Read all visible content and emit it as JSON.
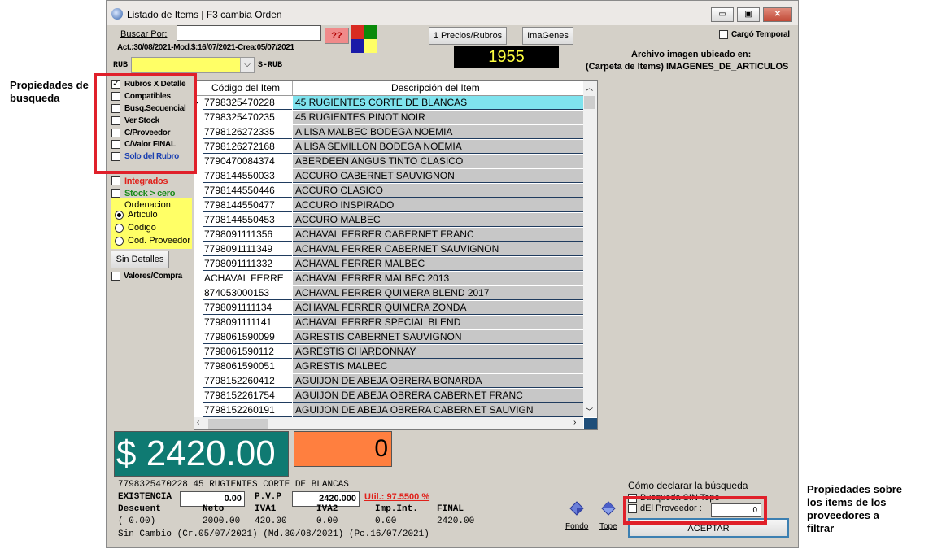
{
  "annotations": {
    "left_label": "Propiedades de\nbusqueda",
    "right_label": "Propiedades sobre\nlos items de los\nproveedores a\nfiltrar"
  },
  "window": {
    "title": "Listado de Items | F3 cambia Orden",
    "minimize": "▭",
    "maximize": "▣",
    "close": "✕"
  },
  "search": {
    "label": "Buscar Por:",
    "value": "",
    "help_button": "??",
    "dates": "Act.:30/08/2021-Mod.$:16/07/2021-Crea:05/07/2021"
  },
  "colors": {
    "accent_red": "#d92b22",
    "accent_green": "#0a8a0a",
    "accent_blue": "#1a1aa8",
    "accent_yellow": "#ffff66",
    "price_bg": "#0f7a72",
    "qty_bg": "#ff7f3f",
    "selected_row": "#7fe3ee",
    "counter_bg": "#000000",
    "counter_fg": "#ffff40"
  },
  "toolbar": {
    "precios_rubros": "1 Precios/Rubros",
    "imagenes": "ImaGenes",
    "counter": "1955",
    "cargo_temporal": "Cargó Temporal"
  },
  "image_info": {
    "line1": "Archivo imagen ubicado en:",
    "line2": "(Carpeta de Items) IMAGENES_DE_ARTICULOS"
  },
  "rubro": {
    "label": "RUB",
    "value": "",
    "srubro_label": "S-RUB"
  },
  "options": [
    {
      "label": "Rubros X Detalle",
      "checked": true,
      "color": "#000000"
    },
    {
      "label": "Compatibles",
      "checked": false,
      "color": "#000000"
    },
    {
      "label": "Busq.Secuencial",
      "checked": false,
      "color": "#000000"
    },
    {
      "label": "Ver Stock",
      "checked": false,
      "color": "#000000"
    },
    {
      "label": "C/Proveedor",
      "checked": false,
      "color": "#000000"
    },
    {
      "label": "C/Valor FINAL",
      "checked": false,
      "color": "#000000"
    },
    {
      "label": "Solo del Rubro",
      "checked": false,
      "color": "#1a3fb0"
    },
    {
      "label": "Integrados",
      "checked": false,
      "color": "#e0201a"
    },
    {
      "label": "Stock > cero",
      "checked": false,
      "color": "#1a8a1a"
    }
  ],
  "ordenacion": {
    "title": "Ordenacion",
    "items": [
      {
        "label": "Articulo",
        "selected": true
      },
      {
        "label": "Codigo",
        "selected": false
      },
      {
        "label": "Cod. Proveedor",
        "selected": false
      }
    ]
  },
  "sin_detalles": "Sin Detalles",
  "valores_compra": "Valores/Compra",
  "table": {
    "headers": [
      "Código del Item",
      "Descripción del Item"
    ],
    "rows": [
      [
        "7798325470228",
        "45 RUGIENTES CORTE DE BLANCAS"
      ],
      [
        "7798325470235",
        "45 RUGIENTES PINOT NOIR"
      ],
      [
        "7798126272335",
        "A LISA MALBEC BODEGA NOEMIA"
      ],
      [
        "7798126272168",
        "A LISA SEMILLON BODEGA NOEMIA"
      ],
      [
        "7790470084374",
        "ABERDEEN ANGUS  TINTO CLASICO"
      ],
      [
        "7798144550033",
        "ACCURO CABERNET SAUVIGNON"
      ],
      [
        "7798144550446",
        "ACCURO CLASICO"
      ],
      [
        "7798144550477",
        "ACCURO INSPIRADO"
      ],
      [
        "7798144550453",
        "ACCURO MALBEC"
      ],
      [
        "7798091111356",
        "ACHAVAL FERRER CABERNET FRANC"
      ],
      [
        "7798091111349",
        "ACHAVAL FERRER CABERNET SAUVIGNON"
      ],
      [
        "7798091111332",
        "ACHAVAL FERRER MALBEC"
      ],
      [
        "ACHAVAL FERRE",
        "ACHAVAL FERRER MALBEC 2013"
      ],
      [
        "874053000153",
        "ACHAVAL FERRER QUIMERA BLEND 2017"
      ],
      [
        "7798091111134",
        "ACHAVAL FERRER QUIMERA ZONDA"
      ],
      [
        "7798091111141",
        "ACHAVAL FERRER SPECIAL BLEND"
      ],
      [
        "7798061590099",
        "AGRESTIS CABERNET SAUVIGNON"
      ],
      [
        "7798061590112",
        "AGRESTIS CHARDONNAY"
      ],
      [
        "7798061590051",
        "AGRESTIS MALBEC"
      ],
      [
        "7798152260412",
        "AGUIJON DE ABEJA OBRERA BONARDA"
      ],
      [
        "7798152261754",
        "AGUIJON DE ABEJA OBRERA CABERNET FRANC"
      ],
      [
        "7798152260191",
        "AGUIJON DE ABEJA OBRERA CABERNET SAUVIGN"
      ]
    ]
  },
  "price": {
    "big": "$ 2420.00",
    "qty": "0"
  },
  "detail": {
    "item_line": "7798325470228 45 RUGIENTES CORTE DE BLANCAS",
    "existencia_label": "EXISTENCIA",
    "existencia_value": "0.00",
    "pvp_label": "P.V.P",
    "pvp_value": "2420.000",
    "util": "Util.: 97.5500 %",
    "col_headers": [
      "Descuent",
      "Neto",
      "IVA1",
      "IVA2",
      "Imp.Int.",
      "FINAL"
    ],
    "col_values": [
      "( 0.00)",
      "2000.00",
      "420.00",
      "0.00",
      "0.00",
      "2420.00"
    ],
    "footer": "Sin Cambio (Cr.05/07/2021) (Md.30/08/2021) (Pc.16/07/2021)"
  },
  "bottom": {
    "fondo": "Fondo",
    "tope": "Tope",
    "como_declarar": "Cómo declarar la búsqueda",
    "busqueda_sin_tope": "Busqueda SIN Tope",
    "del_proveedor": "dEl Proveedor :",
    "proveedor_value": "0",
    "aceptar": "ACEPTAR"
  }
}
